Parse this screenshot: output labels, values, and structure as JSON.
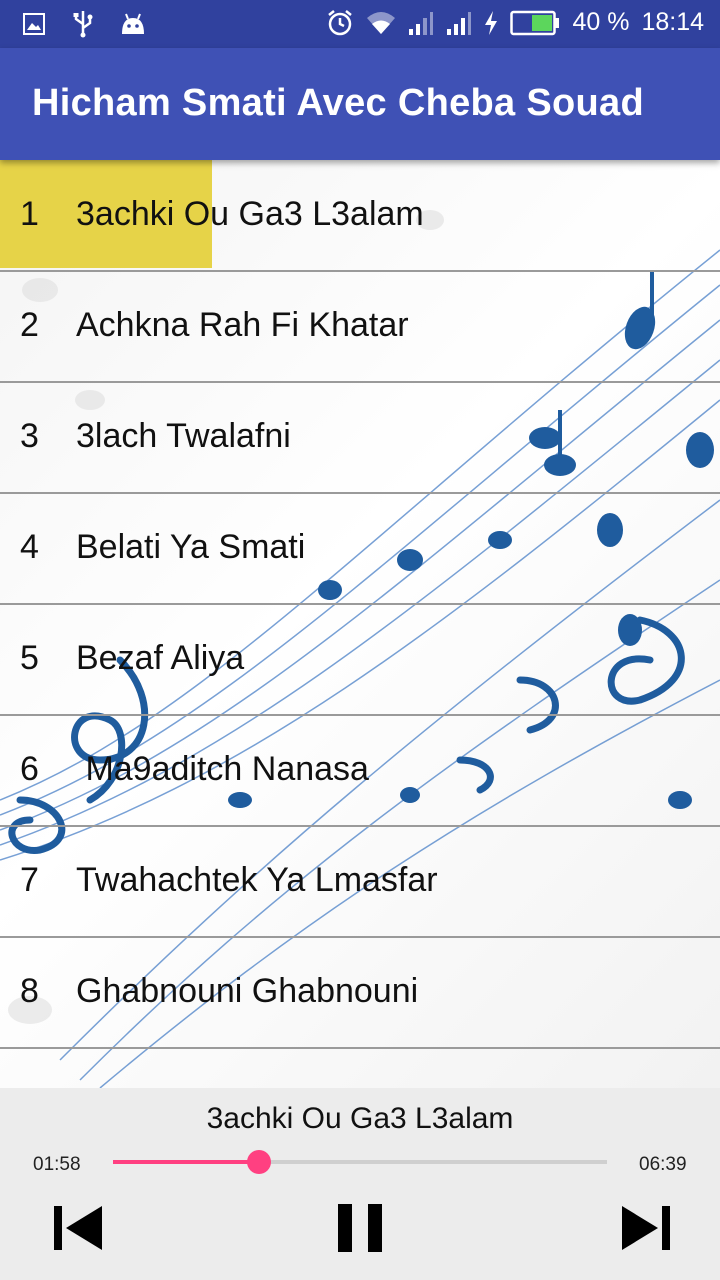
{
  "status_bar": {
    "battery": "40 %",
    "time": "18:14",
    "icons": [
      "image-icon",
      "usb-icon",
      "android-icon",
      "alarm-icon",
      "wifi-icon",
      "signal-icon",
      "signal-icon",
      "charging-icon",
      "battery-icon"
    ]
  },
  "app_bar": {
    "title": "Hicham Smati Avec Cheba Souad"
  },
  "songs": [
    {
      "num": "1",
      "title": "3achki Ou Ga3 L3alam"
    },
    {
      "num": "2",
      "title": "Achkna Rah Fi Khatar"
    },
    {
      "num": "3",
      "title": "3lach Twalafni"
    },
    {
      "num": "4",
      "title": "Belati Ya Smati"
    },
    {
      "num": "5",
      "title": "Bezaf Aliya"
    },
    {
      "num": "6",
      "title": " Ma9aditch Nanasa"
    },
    {
      "num": "7",
      "title": "Twahachtek Ya Lmasfar"
    },
    {
      "num": "8",
      "title": "Ghabnouni Ghabnouni"
    }
  ],
  "player": {
    "now_playing": "3achki Ou Ga3 L3alam",
    "elapsed": "01:58",
    "duration": "06:39",
    "progress": 0.296,
    "accent": "#ff4081"
  },
  "colors": {
    "primary": "#3f51b5",
    "primary_dark": "#30419e",
    "highlight": "#e6d348"
  }
}
